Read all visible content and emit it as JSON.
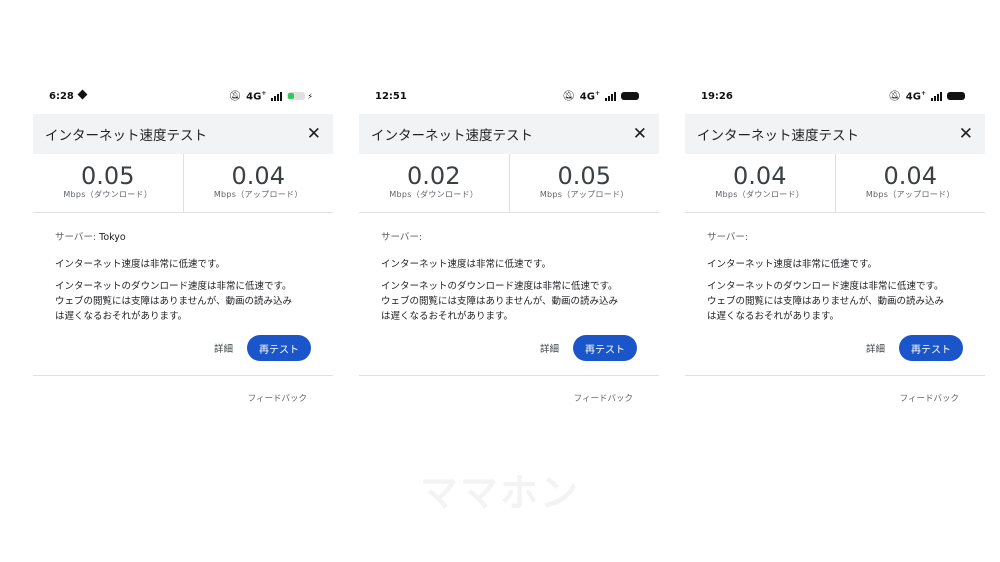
{
  "screens": [
    {
      "time": "6:28",
      "battery": "low",
      "network": "4G",
      "title": "インターネット速度テスト",
      "close": "✕",
      "download": "0.05",
      "download_unit": "Mbps（ダウンロード）",
      "upload": "0.04",
      "upload_unit": "Mbps（アップロード）",
      "server_label": "サーバー:",
      "server_value": "Tokyo",
      "message1": "インターネット速度は非常に低速です。",
      "message2_line1": "インターネットのダウンロード速度は非常に低速です。",
      "message2_line2": "ウェブの閲覧には支障はありませんが、動画の読み込み",
      "message2_line3": "は遅くなるおそれがあります。",
      "details": "詳細",
      "retest": "再テスト",
      "feedback": "フィードバック"
    },
    {
      "time": "12:51",
      "battery": "full",
      "network": "4G",
      "title": "インターネット速度テスト",
      "close": "✕",
      "download": "0.02",
      "download_unit": "Mbps（ダウンロード）",
      "upload": "0.05",
      "upload_unit": "Mbps（アップロード）",
      "server_label": "サーバー:",
      "server_value": "",
      "message1": "インターネット速度は非常に低速です。",
      "message2_line1": "インターネットのダウンロード速度は非常に低速です。",
      "message2_line2": "ウェブの閲覧には支障はありませんが、動画の読み込み",
      "message2_line3": "は遅くなるおそれがあります。",
      "details": "詳細",
      "retest": "再テスト",
      "feedback": "フィードバック"
    },
    {
      "time": "19:26",
      "battery": "full",
      "network": "4G",
      "title": "インターネット速度テスト",
      "close": "✕",
      "download": "0.04",
      "download_unit": "Mbps（ダウンロード）",
      "upload": "0.04",
      "upload_unit": "Mbps（アップロード）",
      "server_label": "サーバー:",
      "server_value": "",
      "message1": "インターネット速度は非常に低速です。",
      "message2_line1": "インターネットのダウンロード速度は非常に低速です。",
      "message2_line2": "ウェブの閲覧には支障はありませんが、動画の読み込み",
      "message2_line3": "は遅くなるおそれがあります。",
      "details": "詳細",
      "retest": "再テスト",
      "feedback": "フィードバック"
    }
  ],
  "watermark": "ママホン",
  "colors": {
    "accent": "#1a56c9",
    "header_bg": "#f1f3f4",
    "divider": "#e0e0e0"
  }
}
